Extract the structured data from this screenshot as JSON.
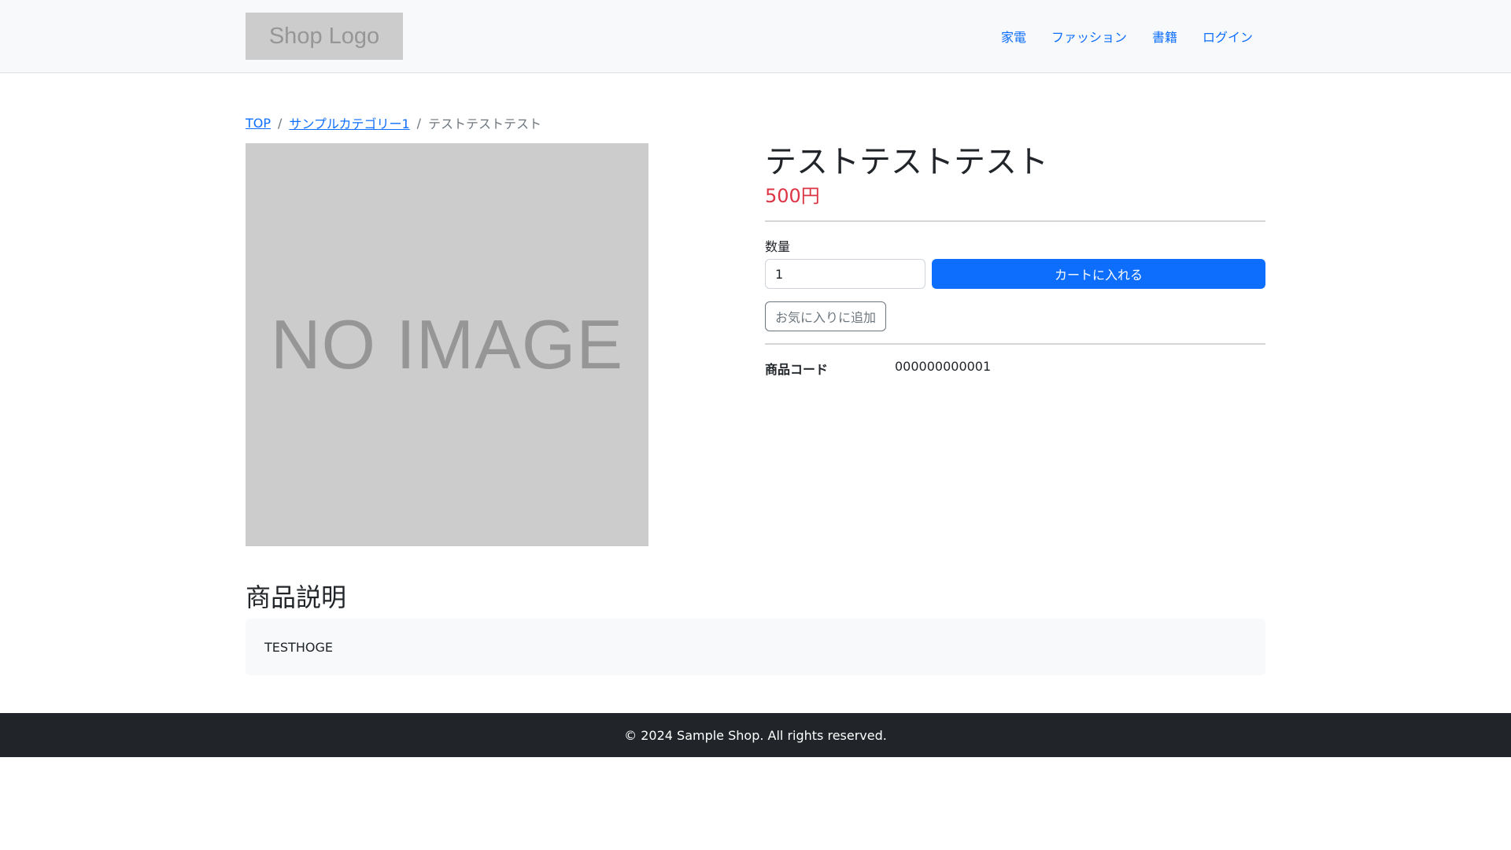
{
  "header": {
    "logo_text": "Shop Logo",
    "nav": [
      "家電",
      "ファッション",
      "書籍",
      "ログイン"
    ]
  },
  "breadcrumb": {
    "top": "TOP",
    "category": "サンプルカテゴリー1",
    "current": "テストテストテスト",
    "separator": "/"
  },
  "product": {
    "image_text": "NO IMAGE",
    "title": "テストテストテスト",
    "price": "500円",
    "quantity_label": "数量",
    "quantity_value": "1",
    "cart_button": "カートに入れる",
    "favorite_button": "お気に入りに追加",
    "code_label": "商品コード",
    "code_value": "000000000001"
  },
  "description": {
    "heading": "商品説明",
    "body": "TESTHOGE"
  },
  "footer": {
    "copyright": "© 2024 Sample Shop. All rights reserved."
  },
  "colors": {
    "accent": "#0d6efd",
    "price": "#dc3545",
    "footer_bg": "#212529"
  }
}
